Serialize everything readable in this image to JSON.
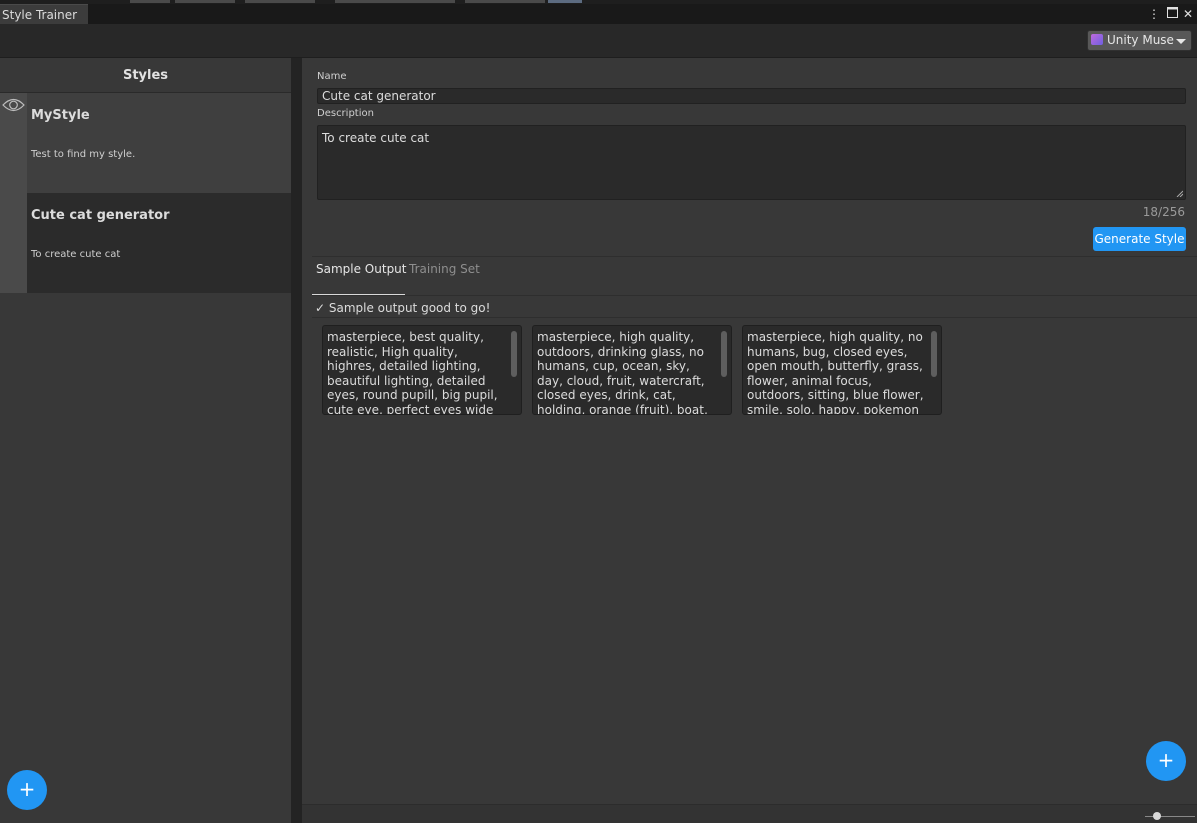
{
  "window": {
    "tab_title": "Style Trainer"
  },
  "toolbar": {
    "muse_label": "Unity Muse"
  },
  "left_panel": {
    "header": "Styles",
    "styles": [
      {
        "title": "MyStyle",
        "description": "Test to find my style."
      },
      {
        "title": "Cute cat generator",
        "description": "To create cute cat"
      }
    ],
    "add_label": "+"
  },
  "details": {
    "name_label": "Name",
    "name_value": "Cute cat generator",
    "description_label": "Description",
    "description_value": "To create cute cat",
    "char_count": "18/256",
    "generate_label": "Generate Style",
    "tabs": [
      "Sample Output",
      "Training Set"
    ],
    "status": "✓ Sample output good to go!",
    "samples": [
      "masterpiece, best quality, realistic, High quality, highres, detailed lighting, beautiful lighting, detailed eyes, round pupill, big pupil, cute eye, perfect eyes wide shot",
      "masterpiece, high quality, outdoors, drinking glass, no humans, cup, ocean, sky, day, cloud, fruit, watercraft, closed eyes, drink, cat, holding, orange (fruit), boat, food",
      "masterpiece, high quality, no humans, bug, closed eyes, open mouth, butterfly, grass, flower, animal focus, outdoors, sitting, blue flower, smile, solo, happy, pokemon (creature), full"
    ],
    "add_label": "+"
  }
}
